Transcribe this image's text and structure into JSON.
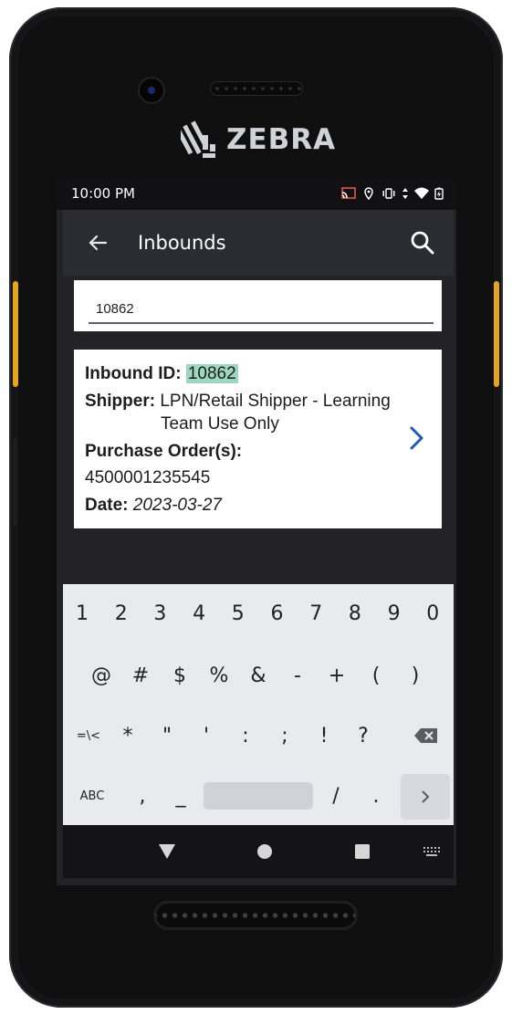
{
  "device": {
    "brand": "ZEBRA"
  },
  "status_bar": {
    "time": "10:00 PM",
    "icons": [
      "cast-icon",
      "location-icon",
      "vibrate-icon",
      "data-arrows-icon",
      "wifi-icon",
      "battery-charging-icon"
    ]
  },
  "app_bar": {
    "title": "Inbounds",
    "back_icon": "arrow-left-icon",
    "search_icon": "search-icon"
  },
  "search": {
    "value": "10862"
  },
  "result": {
    "inbound_label": "Inbound ID:",
    "inbound_id": "10862",
    "shipper_label": "Shipper:",
    "shipper_line1": "LPN/Retail Shipper - Learning",
    "shipper_line2": "Team Use Only",
    "po_label": "Purchase Order(s):",
    "po_value": "4500001235545",
    "date_label": "Date:",
    "date_value": "2023-03-27",
    "accent_color": "#1e5bb8",
    "highlight_color": "#9ed7bf"
  },
  "keyboard": {
    "row1": [
      "1",
      "2",
      "3",
      "4",
      "5",
      "6",
      "7",
      "8",
      "9",
      "0"
    ],
    "row2": [
      "@",
      "#",
      "$",
      "%",
      "&",
      "-",
      "+",
      "(",
      ")"
    ],
    "row3": [
      "=\\<",
      "*",
      "\"",
      "'",
      ":",
      ";",
      "!",
      "?"
    ],
    "row4": {
      "abc": "ABC",
      "comma": ",",
      "underscore": "_",
      "slash": "/",
      "period": "."
    }
  },
  "nav_bar": {
    "icons": [
      "back-triangle-icon",
      "home-circle-icon",
      "recents-square-icon",
      "keyboard-icon"
    ]
  }
}
